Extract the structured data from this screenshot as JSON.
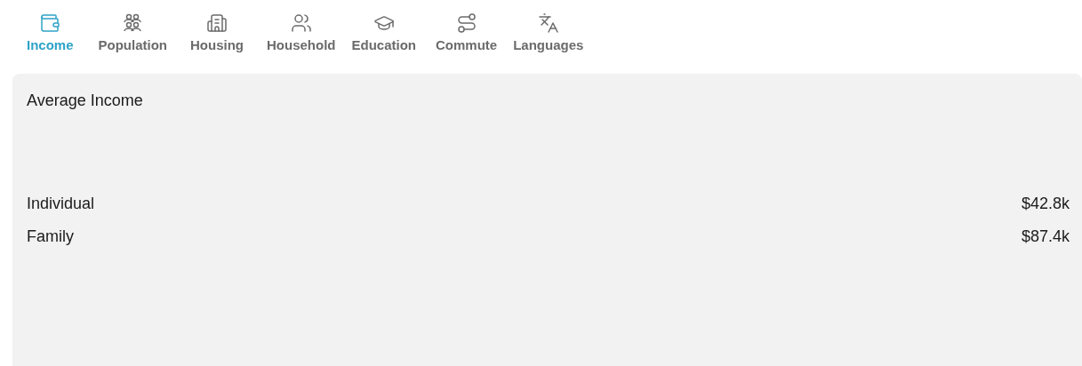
{
  "tabs": [
    {
      "label": "Income",
      "selected": true
    },
    {
      "label": "Population",
      "selected": false
    },
    {
      "label": "Housing",
      "selected": false
    },
    {
      "label": "Household",
      "selected": false
    },
    {
      "label": "Education",
      "selected": false
    },
    {
      "label": "Commute",
      "selected": false
    },
    {
      "label": "Languages",
      "selected": false
    }
  ],
  "panel": {
    "title": "Average Income",
    "rows": [
      {
        "label": "Individual",
        "value": "$42.8k"
      },
      {
        "label": "Family",
        "value": "$87.4k"
      }
    ]
  }
}
